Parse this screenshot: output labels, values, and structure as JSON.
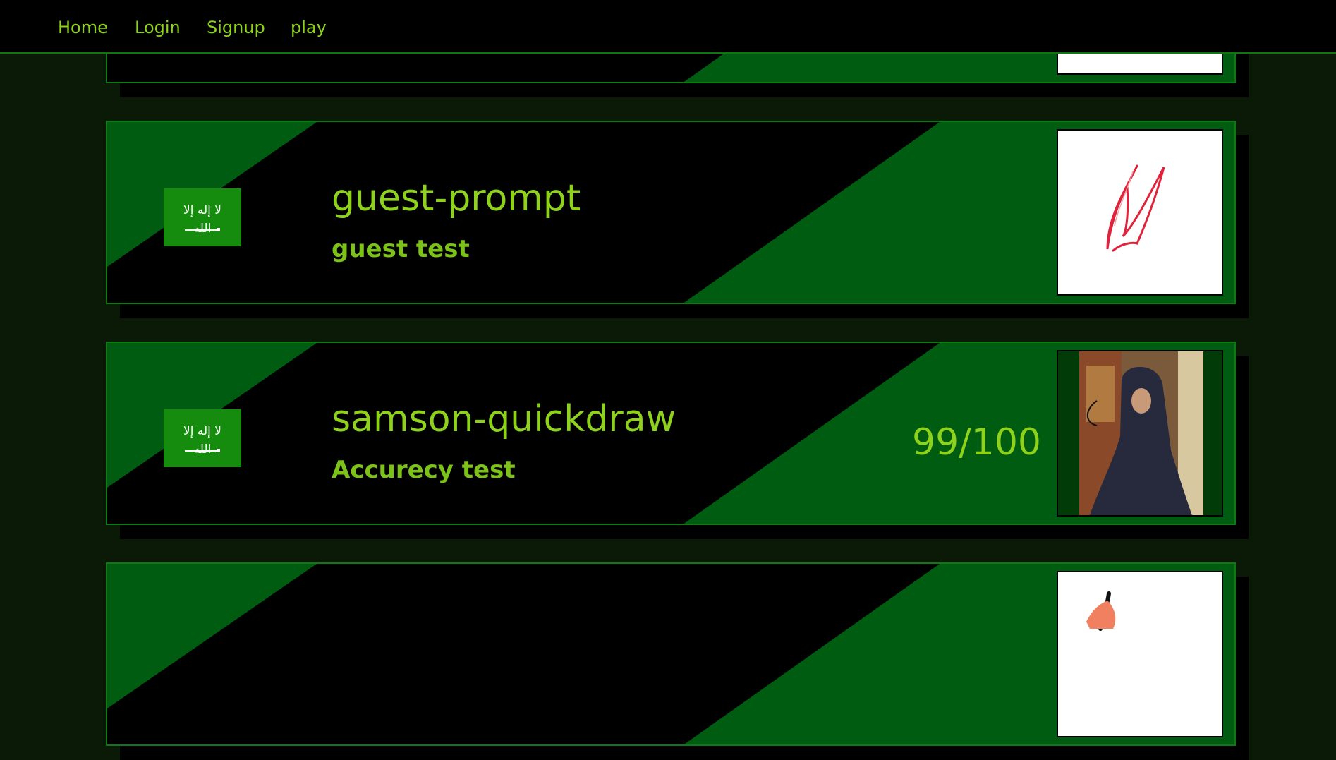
{
  "nav": {
    "items": [
      {
        "label": "Home"
      },
      {
        "label": "Login"
      },
      {
        "label": "Signup"
      },
      {
        "label": "play"
      }
    ]
  },
  "flag": {
    "script_text": "لا إله إلا الله",
    "name": "saudi-arabia-flag-icon"
  },
  "entries": [
    {
      "title": "guest-prompt",
      "subtitle": "guest test",
      "score": "",
      "thumbnail": "red-scribble-drawing"
    },
    {
      "title": "samson-quickdraw",
      "subtitle": "Accurecy test",
      "score": "99/100",
      "thumbnail": "portrait-photo-with-sketch-overlay"
    }
  ],
  "colors": {
    "background": "#0b1a07",
    "card_green": "#005c10",
    "accent_text": "#8ed21c",
    "nav_bg": "#000000",
    "flag_green": "#168c0e"
  }
}
